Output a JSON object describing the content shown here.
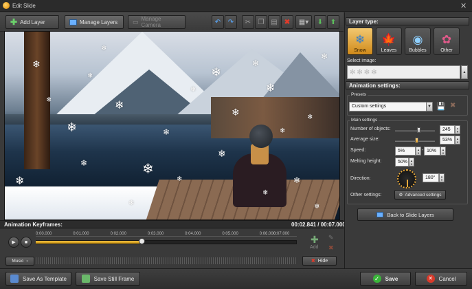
{
  "window": {
    "title": "Edit Slide"
  },
  "toolbar": {
    "add_layer": "Add Layer",
    "manage_layers": "Manage Layers",
    "manage_camera": "Manage Camera"
  },
  "timeline": {
    "title": "Animation Keyframes:",
    "current_time": "00:02.841",
    "total_time": "00:07.000",
    "ticks": [
      "0:00.000",
      "0:01.000",
      "0:02.000",
      "0:03.000",
      "0:04.000",
      "0:05.000",
      "0:06.000",
      "0:07.000"
    ],
    "progress": 0.406,
    "add_label": "Add",
    "music_label": "Music",
    "hide_label": "Hide"
  },
  "bottom": {
    "save_template": "Save As Template",
    "save_still": "Save Still Frame",
    "save": "Save",
    "cancel": "Cancel"
  },
  "panel": {
    "layer_type_title": "Layer type:",
    "layer_types": [
      {
        "label": "Snow",
        "icon": "snowflake-icon",
        "selected": true
      },
      {
        "label": "Leaves",
        "icon": "leaf-icon",
        "selected": false
      },
      {
        "label": "Bubbles",
        "icon": "bubble-icon",
        "selected": false
      },
      {
        "label": "Other",
        "icon": "shapes-icon",
        "selected": false
      }
    ],
    "select_image_label": "Select image:",
    "animation_title": "Animation settings:",
    "presets_label": "Presets",
    "preset_value": "Custom settings",
    "main_settings_label": "Main settings",
    "objects_label": "Number of objects:",
    "objects_value": "245",
    "objects_level": 0.59,
    "avg_size_label": "Average size:",
    "avg_size_value": "53%",
    "avg_size_level": 0.53,
    "speed_label": "Speed:",
    "speed_from": "5%",
    "speed_dash": "-",
    "speed_to": "10%",
    "melting_label": "Melting height:",
    "melting_value": "50%",
    "direction_label": "Direction:",
    "direction_value": "180°",
    "other_label": "Other settings:",
    "advanced_button": "Advanced settings",
    "back_button": "Back to Slide Layers"
  },
  "colors": {
    "accent": "#e9a93a",
    "bg": "#3a3a3a"
  }
}
